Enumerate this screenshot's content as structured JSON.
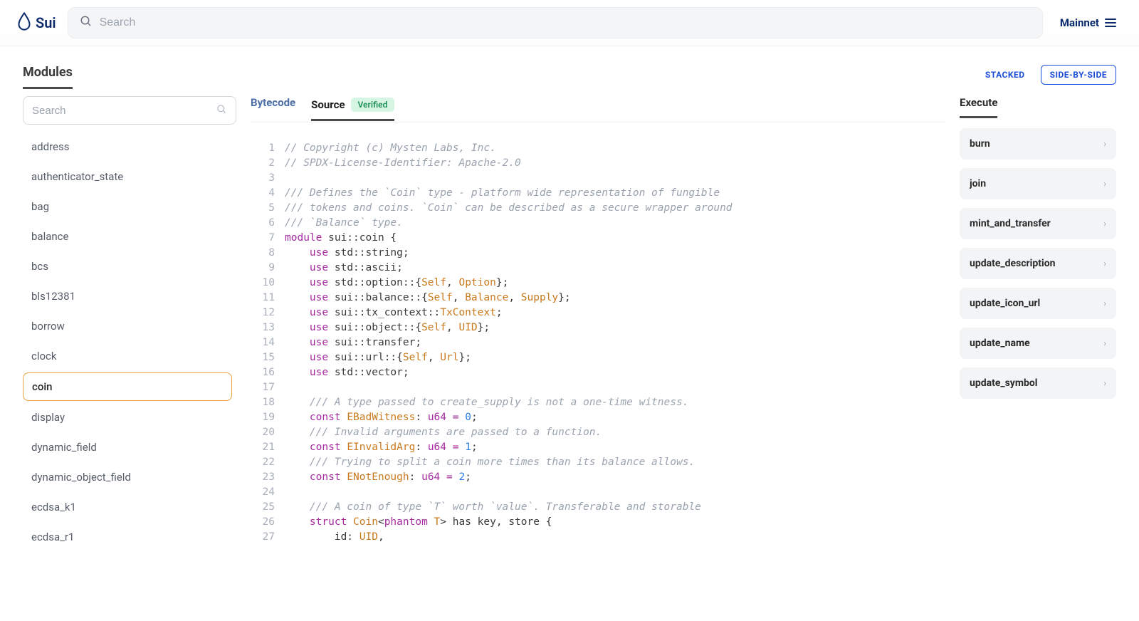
{
  "header": {
    "brand": "Sui",
    "search_placeholder": "Search",
    "network_label": "Mainnet"
  },
  "section": {
    "title": "Modules",
    "view_stacked": "STACKED",
    "view_side_by_side": "SIDE-BY-SIDE"
  },
  "sidebar": {
    "search_placeholder": "Search",
    "active_module": "coin",
    "modules": [
      "address",
      "authenticator_state",
      "bag",
      "balance",
      "bcs",
      "bls12381",
      "borrow",
      "clock",
      "coin",
      "display",
      "dynamic_field",
      "dynamic_object_field",
      "ecdsa_k1",
      "ecdsa_r1"
    ]
  },
  "code_panel": {
    "tab_bytecode": "Bytecode",
    "tab_source": "Source",
    "verified_label": "Verified",
    "lines": [
      [
        {
          "t": "comment",
          "v": "// Copyright (c) Mysten Labs, Inc."
        }
      ],
      [
        {
          "t": "comment",
          "v": "// SPDX-License-Identifier: Apache-2.0"
        }
      ],
      [],
      [
        {
          "t": "comment",
          "v": "/// Defines the `Coin` type - platform wide representation of fungible"
        }
      ],
      [
        {
          "t": "comment",
          "v": "/// tokens and coins. `Coin` can be described as a secure wrapper around"
        }
      ],
      [
        {
          "t": "comment",
          "v": "/// `Balance` type."
        }
      ],
      [
        {
          "t": "keyword",
          "v": "module"
        },
        {
          "t": "ident",
          "v": " sui::coin "
        },
        {
          "t": "punct",
          "v": "{"
        }
      ],
      [
        {
          "t": "ident",
          "v": "    "
        },
        {
          "t": "keyword",
          "v": "use"
        },
        {
          "t": "ident",
          "v": " std::string;"
        }
      ],
      [
        {
          "t": "ident",
          "v": "    "
        },
        {
          "t": "keyword",
          "v": "use"
        },
        {
          "t": "ident",
          "v": " std::ascii;"
        }
      ],
      [
        {
          "t": "ident",
          "v": "    "
        },
        {
          "t": "keyword",
          "v": "use"
        },
        {
          "t": "ident",
          "v": " std::option::{"
        },
        {
          "t": "type",
          "v": "Self"
        },
        {
          "t": "punct",
          "v": ", "
        },
        {
          "t": "type",
          "v": "Option"
        },
        {
          "t": "punct",
          "v": "};"
        }
      ],
      [
        {
          "t": "ident",
          "v": "    "
        },
        {
          "t": "keyword",
          "v": "use"
        },
        {
          "t": "ident",
          "v": " sui::balance::{"
        },
        {
          "t": "type",
          "v": "Self"
        },
        {
          "t": "punct",
          "v": ", "
        },
        {
          "t": "type",
          "v": "Balance"
        },
        {
          "t": "punct",
          "v": ", "
        },
        {
          "t": "type",
          "v": "Supply"
        },
        {
          "t": "punct",
          "v": "};"
        }
      ],
      [
        {
          "t": "ident",
          "v": "    "
        },
        {
          "t": "keyword",
          "v": "use"
        },
        {
          "t": "ident",
          "v": " sui::tx_context::"
        },
        {
          "t": "type",
          "v": "TxContext"
        },
        {
          "t": "punct",
          "v": ";"
        }
      ],
      [
        {
          "t": "ident",
          "v": "    "
        },
        {
          "t": "keyword",
          "v": "use"
        },
        {
          "t": "ident",
          "v": " sui::object::{"
        },
        {
          "t": "type",
          "v": "Self"
        },
        {
          "t": "punct",
          "v": ", "
        },
        {
          "t": "type",
          "v": "UID"
        },
        {
          "t": "punct",
          "v": "};"
        }
      ],
      [
        {
          "t": "ident",
          "v": "    "
        },
        {
          "t": "keyword",
          "v": "use"
        },
        {
          "t": "ident",
          "v": " sui::transfer;"
        }
      ],
      [
        {
          "t": "ident",
          "v": "    "
        },
        {
          "t": "keyword",
          "v": "use"
        },
        {
          "t": "ident",
          "v": " sui::url::{"
        },
        {
          "t": "type",
          "v": "Self"
        },
        {
          "t": "punct",
          "v": ", "
        },
        {
          "t": "type",
          "v": "Url"
        },
        {
          "t": "punct",
          "v": "};"
        }
      ],
      [
        {
          "t": "ident",
          "v": "    "
        },
        {
          "t": "keyword",
          "v": "use"
        },
        {
          "t": "ident",
          "v": " std::vector;"
        }
      ],
      [],
      [
        {
          "t": "ident",
          "v": "    "
        },
        {
          "t": "comment",
          "v": "/// A type passed to create_supply is not a one-time witness."
        }
      ],
      [
        {
          "t": "ident",
          "v": "    "
        },
        {
          "t": "keyword",
          "v": "const"
        },
        {
          "t": "ident",
          "v": " "
        },
        {
          "t": "type",
          "v": "EBadWitness"
        },
        {
          "t": "punct",
          "v": ": "
        },
        {
          "t": "keyword",
          "v": "u64"
        },
        {
          "t": "ident",
          "v": " "
        },
        {
          "t": "op",
          "v": "="
        },
        {
          "t": "ident",
          "v": " "
        },
        {
          "t": "number",
          "v": "0"
        },
        {
          "t": "punct",
          "v": ";"
        }
      ],
      [
        {
          "t": "ident",
          "v": "    "
        },
        {
          "t": "comment",
          "v": "/// Invalid arguments are passed to a function."
        }
      ],
      [
        {
          "t": "ident",
          "v": "    "
        },
        {
          "t": "keyword",
          "v": "const"
        },
        {
          "t": "ident",
          "v": " "
        },
        {
          "t": "type",
          "v": "EInvalidArg"
        },
        {
          "t": "punct",
          "v": ": "
        },
        {
          "t": "keyword",
          "v": "u64"
        },
        {
          "t": "ident",
          "v": " "
        },
        {
          "t": "op",
          "v": "="
        },
        {
          "t": "ident",
          "v": " "
        },
        {
          "t": "number",
          "v": "1"
        },
        {
          "t": "punct",
          "v": ";"
        }
      ],
      [
        {
          "t": "ident",
          "v": "    "
        },
        {
          "t": "comment",
          "v": "/// Trying to split a coin more times than its balance allows."
        }
      ],
      [
        {
          "t": "ident",
          "v": "    "
        },
        {
          "t": "keyword",
          "v": "const"
        },
        {
          "t": "ident",
          "v": " "
        },
        {
          "t": "type",
          "v": "ENotEnough"
        },
        {
          "t": "punct",
          "v": ": "
        },
        {
          "t": "keyword",
          "v": "u64"
        },
        {
          "t": "ident",
          "v": " "
        },
        {
          "t": "op",
          "v": "="
        },
        {
          "t": "ident",
          "v": " "
        },
        {
          "t": "number",
          "v": "2"
        },
        {
          "t": "punct",
          "v": ";"
        }
      ],
      [],
      [
        {
          "t": "ident",
          "v": "    "
        },
        {
          "t": "comment",
          "v": "/// A coin of type `T` worth `value`. Transferable and storable"
        }
      ],
      [
        {
          "t": "ident",
          "v": "    "
        },
        {
          "t": "keyword",
          "v": "struct"
        },
        {
          "t": "ident",
          "v": " "
        },
        {
          "t": "type",
          "v": "Coin"
        },
        {
          "t": "punct",
          "v": "<"
        },
        {
          "t": "keyword",
          "v": "phantom"
        },
        {
          "t": "ident",
          "v": " "
        },
        {
          "t": "type",
          "v": "T"
        },
        {
          "t": "punct",
          "v": ">"
        },
        {
          "t": "ident",
          "v": " has key, store "
        },
        {
          "t": "punct",
          "v": "{"
        }
      ],
      [
        {
          "t": "ident",
          "v": "        id: "
        },
        {
          "t": "type",
          "v": "UID"
        },
        {
          "t": "punct",
          "v": ","
        }
      ]
    ]
  },
  "execute": {
    "title": "Execute",
    "functions": [
      "burn",
      "join",
      "mint_and_transfer",
      "update_description",
      "update_icon_url",
      "update_name",
      "update_symbol"
    ]
  }
}
